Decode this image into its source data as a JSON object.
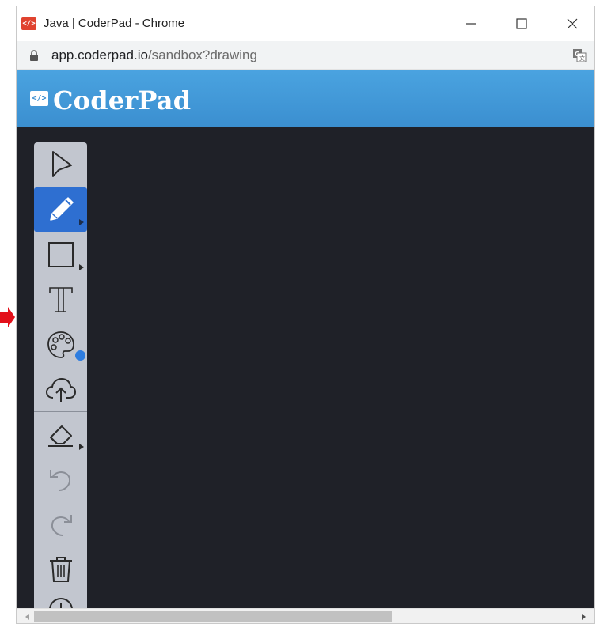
{
  "window": {
    "title": "Java | CoderPad - Chrome",
    "favicon_text": "</>"
  },
  "address": {
    "host": "app.coderpad.io",
    "path": "/sandbox?drawing"
  },
  "app": {
    "logo_mark": "</>",
    "logo_text": "CoderPad",
    "brand_color": "#3b8fd0",
    "canvas_color": "#1f2128",
    "toolbar_color": "#c2c6cf",
    "active_tool_color": "#2e6fd1"
  },
  "tools": [
    {
      "name": "select",
      "icon": "cursor-arrow-icon"
    },
    {
      "name": "pencil",
      "icon": "pencil-icon",
      "active": true
    },
    {
      "name": "rectangle",
      "icon": "rectangle-icon"
    },
    {
      "name": "text",
      "icon": "text-icon"
    },
    {
      "name": "color",
      "icon": "palette-icon"
    },
    {
      "name": "upload",
      "icon": "cloud-upload-icon"
    },
    {
      "name": "eraser",
      "icon": "eraser-icon"
    },
    {
      "name": "undo",
      "icon": "undo-icon"
    },
    {
      "name": "redo",
      "icon": "redo-icon"
    },
    {
      "name": "clear",
      "icon": "trash-icon"
    },
    {
      "name": "info",
      "icon": "info-icon"
    }
  ]
}
